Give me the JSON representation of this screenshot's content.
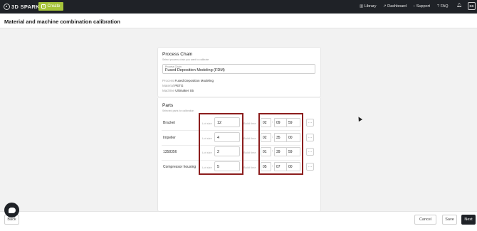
{
  "nav": {
    "logo": "3D SPARK",
    "create_label": "Create",
    "library_label": "Library",
    "dashboard_label": "Dashboard",
    "support_label": "Support",
    "faq_label": "FAQ",
    "avatar_initials": "BB"
  },
  "page": {
    "title": "Material and machine combination calibration"
  },
  "process_chain": {
    "title": "Process Chain",
    "subtitle": "Select process chain you want to calibrate",
    "field_label": "Process Chain",
    "field_value": "Fused Deposition Modeling (FDM)",
    "details": [
      {
        "label": "Process",
        "value": "Fused Deposition Modeling"
      },
      {
        "label": "Material",
        "value": "PETG"
      },
      {
        "label": "Machine",
        "value": "Ultimaker S5"
      }
    ]
  },
  "parts": {
    "title": "Parts",
    "subtitle": "Selected parts for calibration",
    "lot_size_label": "Lot size",
    "build_time_label": "Build time",
    "rows": [
      {
        "name": "Bracket",
        "lot_size": "12",
        "build_time": [
          "02",
          "09",
          "59"
        ]
      },
      {
        "name": "Impeller",
        "lot_size": "4",
        "build_time": [
          "02",
          "35",
          "00"
        ]
      },
      {
        "name": "1358356",
        "lot_size": "2",
        "build_time": [
          "01",
          "39",
          "59"
        ]
      },
      {
        "name": "Compressor housing",
        "lot_size": "5",
        "build_time": [
          "05",
          "07",
          "00"
        ]
      }
    ]
  },
  "footer": {
    "back_label": "Back",
    "cancel_label": "Cancel",
    "save_label": "Save",
    "next_label": "Next"
  },
  "colors": {
    "topbar": "#1f2227",
    "accent": "#a6c43a",
    "highlight": "#8c1d1d"
  }
}
